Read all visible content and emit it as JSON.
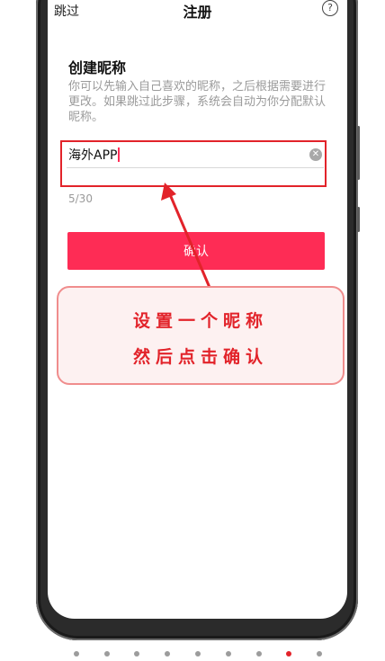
{
  "header": {
    "skip_label": "跳过",
    "title": "注册",
    "help_icon": "question-circle-icon"
  },
  "form": {
    "heading": "创建昵称",
    "description": "你可以先输入自己喜欢的昵称，之后根据需要进行更改。如果跳过此步骤，系统会自动为你分配默认昵称。",
    "nickname_value": "海外APP",
    "clear_icon": "clear-circle-icon",
    "char_counter": "5/30",
    "confirm_label": "确认"
  },
  "annotation": {
    "line1": "设置一个昵称",
    "line2": "然后点击确认",
    "highlight_color": "#e2232a"
  },
  "pager": {
    "count": 9,
    "active_index": 7,
    "active_color": "#e3232a"
  },
  "colors": {
    "accent": "#fe2c55"
  }
}
